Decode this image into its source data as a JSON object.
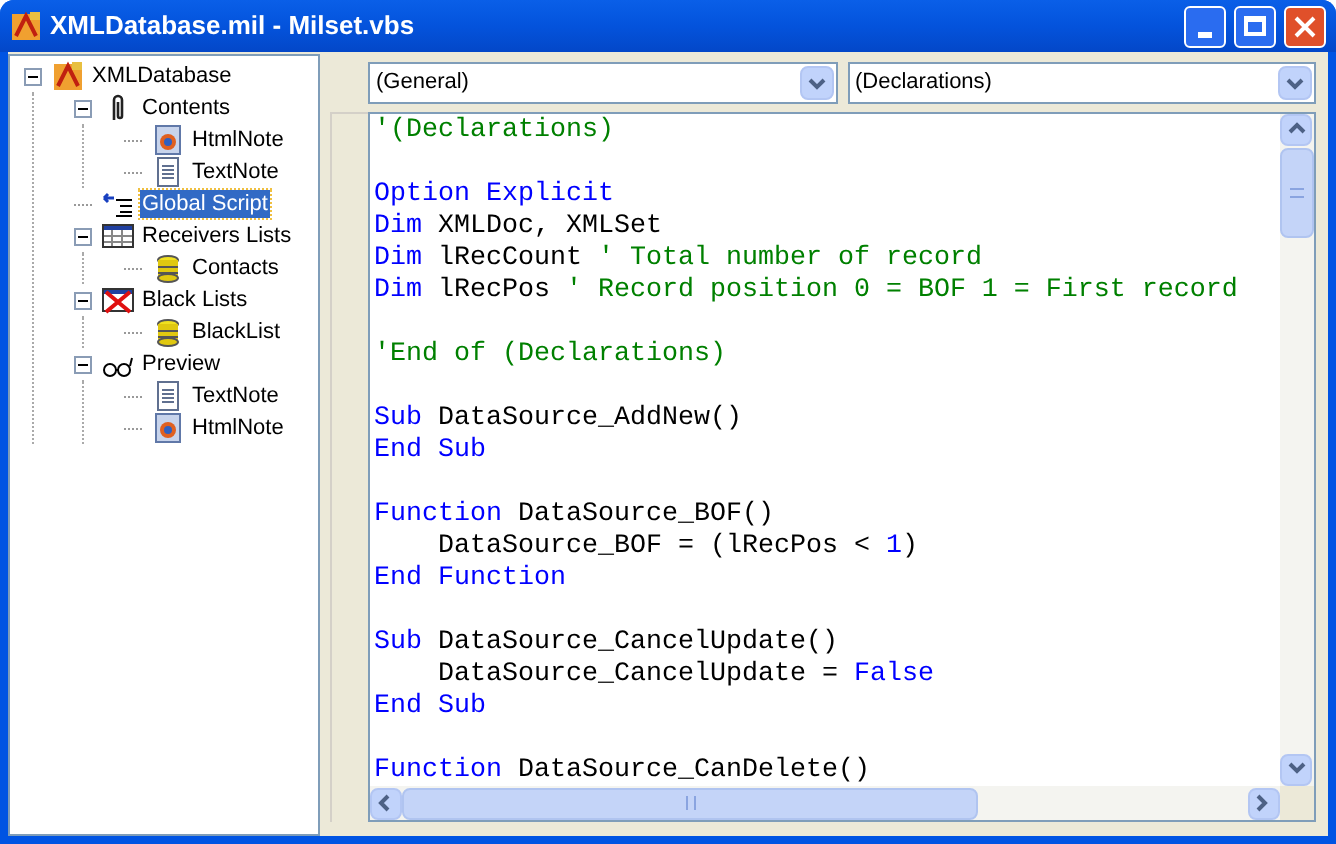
{
  "window": {
    "title": "XMLDatabase.mil - Milset.vbs"
  },
  "tree": [
    {
      "label": "XMLDatabase",
      "kind": "app",
      "selected": false,
      "expanded": true,
      "children": [
        {
          "label": "Contents",
          "kind": "clip",
          "selected": false,
          "expanded": true,
          "children": [
            {
              "label": "HtmlNote",
              "kind": "html",
              "selected": false
            },
            {
              "label": "TextNote",
              "kind": "text",
              "selected": false
            }
          ]
        },
        {
          "label": "Global Script",
          "kind": "script",
          "selected": true
        },
        {
          "label": "Receivers Lists",
          "kind": "grid",
          "selected": false,
          "expanded": true,
          "children": [
            {
              "label": "Contacts",
              "kind": "db",
              "selected": false
            }
          ]
        },
        {
          "label": "Black Lists",
          "kind": "blocked",
          "selected": false,
          "expanded": true,
          "children": [
            {
              "label": "BlackList",
              "kind": "db",
              "selected": false
            }
          ]
        },
        {
          "label": "Preview",
          "kind": "glasses",
          "selected": false,
          "expanded": true,
          "children": [
            {
              "label": "TextNote",
              "kind": "text",
              "selected": false
            },
            {
              "label": "HtmlNote",
              "kind": "html",
              "selected": false
            }
          ]
        }
      ]
    }
  ],
  "object_dropdown": {
    "value": "(General)"
  },
  "procedure_dropdown": {
    "value": "(Declarations)"
  },
  "code_lines": [
    {
      "kind": "code",
      "tokens": [
        {
          "kind": "comment",
          "text": "'(Declarations)"
        }
      ]
    },
    {
      "kind": "blank"
    },
    {
      "kind": "code",
      "tokens": [
        {
          "kind": "keyword",
          "text": "Option Explicit"
        }
      ]
    },
    {
      "kind": "code",
      "tokens": [
        {
          "kind": "keyword",
          "text": "Dim"
        },
        {
          "kind": "plain",
          "text": " XMLDoc, XMLSet"
        }
      ]
    },
    {
      "kind": "code",
      "tokens": [
        {
          "kind": "keyword",
          "text": "Dim"
        },
        {
          "kind": "plain",
          "text": " lRecCount "
        },
        {
          "kind": "comment",
          "text": "' Total number of record"
        }
      ]
    },
    {
      "kind": "code",
      "tokens": [
        {
          "kind": "keyword",
          "text": "Dim"
        },
        {
          "kind": "plain",
          "text": " lRecPos "
        },
        {
          "kind": "comment",
          "text": "' Record position 0 = BOF 1 = First record"
        }
      ]
    },
    {
      "kind": "blank"
    },
    {
      "kind": "code",
      "tokens": [
        {
          "kind": "comment",
          "text": "'End of (Declarations)"
        }
      ]
    },
    {
      "kind": "blank"
    },
    {
      "kind": "code",
      "tokens": [
        {
          "kind": "keyword",
          "text": "Sub"
        },
        {
          "kind": "plain",
          "text": " DataSource_AddNew()"
        }
      ]
    },
    {
      "kind": "code",
      "tokens": [
        {
          "kind": "keyword",
          "text": "End Sub"
        }
      ]
    },
    {
      "kind": "blank"
    },
    {
      "kind": "code",
      "tokens": [
        {
          "kind": "keyword",
          "text": "Function"
        },
        {
          "kind": "plain",
          "text": " DataSource_BOF()"
        }
      ]
    },
    {
      "kind": "code",
      "tokens": [
        {
          "kind": "plain",
          "text": "    DataSource_BOF = (lRecPos < "
        },
        {
          "kind": "number",
          "text": "1"
        },
        {
          "kind": "plain",
          "text": ")"
        }
      ]
    },
    {
      "kind": "code",
      "tokens": [
        {
          "kind": "keyword",
          "text": "End Function"
        }
      ]
    },
    {
      "kind": "blank"
    },
    {
      "kind": "code",
      "tokens": [
        {
          "kind": "keyword",
          "text": "Sub"
        },
        {
          "kind": "plain",
          "text": " DataSource_CancelUpdate()"
        }
      ]
    },
    {
      "kind": "code",
      "tokens": [
        {
          "kind": "plain",
          "text": "    DataSource_CancelUpdate = "
        },
        {
          "kind": "keyword",
          "text": "False"
        }
      ]
    },
    {
      "kind": "code",
      "tokens": [
        {
          "kind": "keyword",
          "text": "End Sub"
        }
      ]
    },
    {
      "kind": "blank"
    },
    {
      "kind": "code",
      "tokens": [
        {
          "kind": "keyword",
          "text": "Function"
        },
        {
          "kind": "plain",
          "text": " DataSource_CanDelete()"
        }
      ]
    }
  ]
}
